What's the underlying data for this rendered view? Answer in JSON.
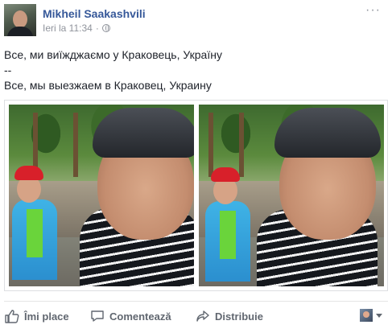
{
  "post": {
    "author": "Mikheil Saakashvili",
    "timestamp": "Ieri la 11:34",
    "separator": "·",
    "privacy_icon": "globe-icon",
    "more_icon": "ellipsis-icon",
    "more_label": "···",
    "text_lines": [
      "Все, ми виїжджаємо у Краковець, Україну",
      "--",
      "Все, мы выезжаем в Краковец, Украину"
    ],
    "photos": [
      {
        "description_icon": "selfie-photo-left"
      },
      {
        "description_icon": "selfie-photo-right"
      }
    ]
  },
  "actions": {
    "like_label": "Îmi place",
    "comment_label": "Comentează",
    "share_label": "Distribuie"
  },
  "colors": {
    "author": "#365899",
    "meta": "#90949c",
    "action": "#616770"
  }
}
